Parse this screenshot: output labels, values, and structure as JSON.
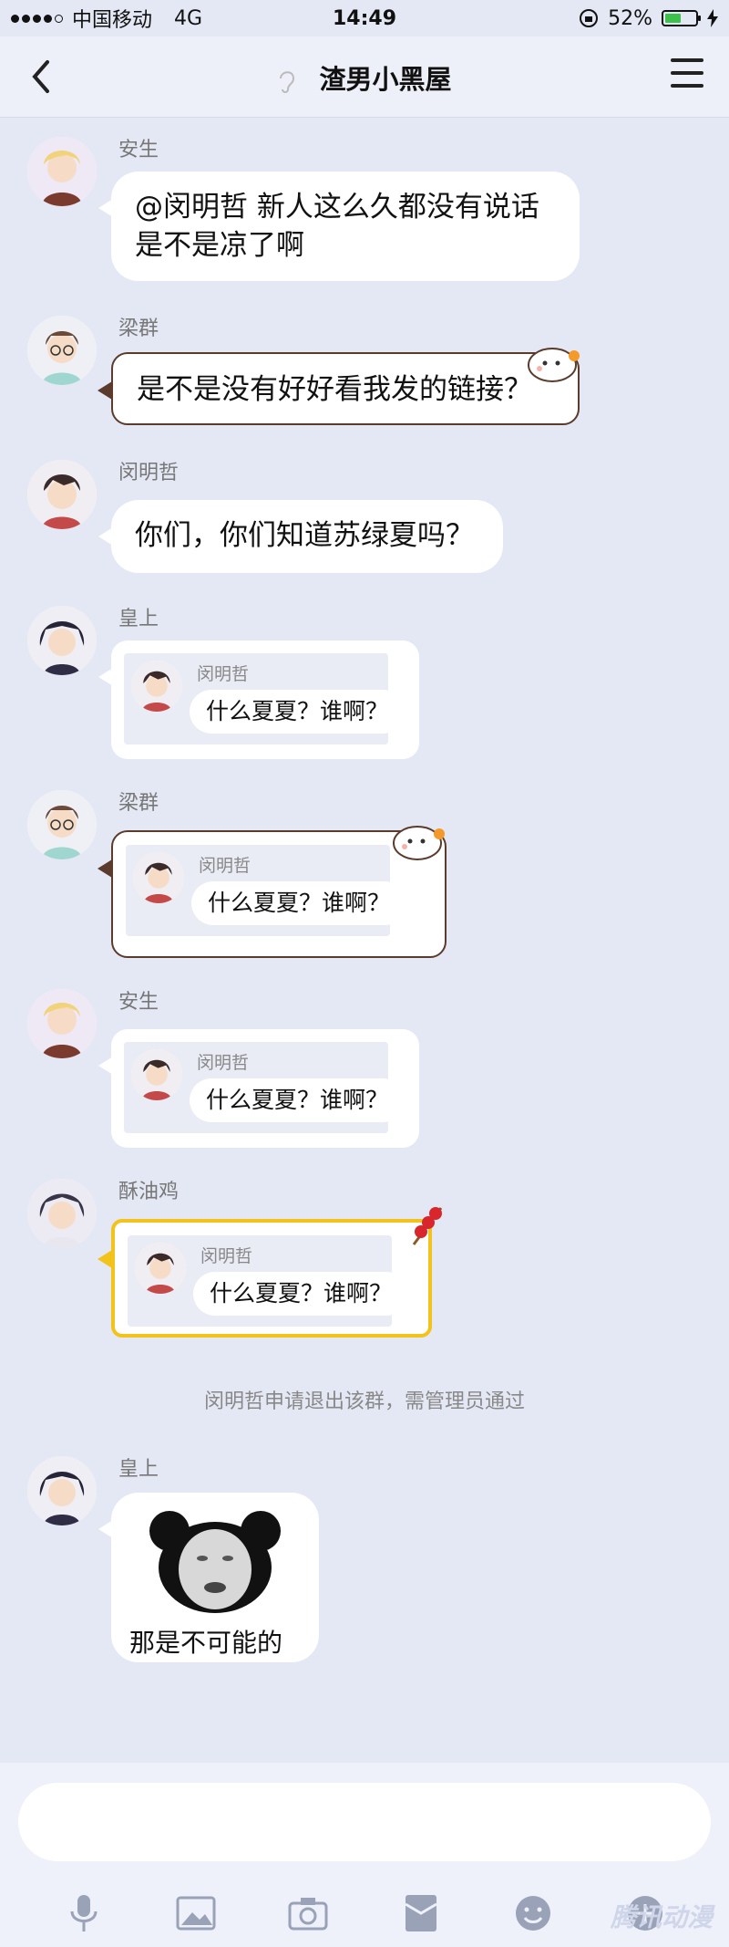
{
  "status_bar": {
    "carrier": "中国移动",
    "network": "4G",
    "time": "14:49",
    "battery": "52%",
    "battery_level": 0.52
  },
  "nav": {
    "title": "渣男小黑屋"
  },
  "messages": [
    {
      "sender": "安生",
      "text_line1": "@闵明哲 新人这么久都没有说话",
      "text_line2": "是不是凉了啊"
    },
    {
      "sender": "梁群",
      "text": "是不是没有好好看我发的链接？"
    },
    {
      "sender": "闵明哲",
      "text": "你们，你们知道苏绿夏吗？"
    },
    {
      "sender": "皇上",
      "fwd_name": "闵明哲",
      "fwd_text": "什么夏夏？谁啊？"
    },
    {
      "sender": "梁群",
      "fwd_name": "闵明哲",
      "fwd_text": "什么夏夏？谁啊？"
    },
    {
      "sender": "安生",
      "fwd_name": "闵明哲",
      "fwd_text": "什么夏夏？谁啊？"
    },
    {
      "sender": "酥油鸡",
      "fwd_name": "闵明哲",
      "fwd_text": "什么夏夏？谁啊？"
    },
    {
      "sender": "皇上",
      "caption": "那是不可能的"
    }
  ],
  "system_notice": "闵明哲申请退出该群，需管理员通过",
  "watermark": "腾讯动漫",
  "icons": [
    "back-icon",
    "ear-icon",
    "menu-icon",
    "microphone-icon",
    "image-icon",
    "camera-icon",
    "red-packet-icon",
    "emoji-icon",
    "plus-icon"
  ]
}
